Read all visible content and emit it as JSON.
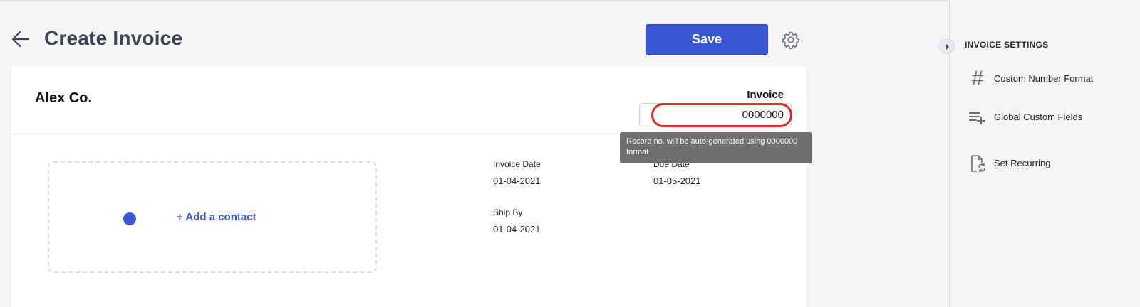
{
  "header": {
    "title": "Create Invoice",
    "save_label": "Save"
  },
  "card": {
    "company_name": "Alex Co.",
    "invoice_label": "Invoice",
    "invoice_number": "0000000",
    "add_contact_label": "+ Add a contact",
    "fields": {
      "invoice_date_label": "Invoice Date",
      "invoice_date_value": "01-04-2021",
      "due_date_label": "Due Date",
      "due_date_value": "01-05-2021",
      "ship_by_label": "Ship By",
      "ship_by_value": "01-04-2021"
    }
  },
  "tooltip": {
    "text": "Record no. will be auto-generated using 0000000 format"
  },
  "side_panel": {
    "title": "INVOICE SETTINGS",
    "items": [
      {
        "label": "Custom Number Format",
        "icon": "hash-icon"
      },
      {
        "label": "Global Custom Fields",
        "icon": "list-add-icon"
      },
      {
        "label": "Set Recurring",
        "icon": "recurring-document-icon"
      }
    ]
  },
  "colors": {
    "accent": "#3a57d8",
    "title": "#3a4258",
    "highlight": "#e3261b",
    "tooltip_bg": "#6f6f6f"
  }
}
